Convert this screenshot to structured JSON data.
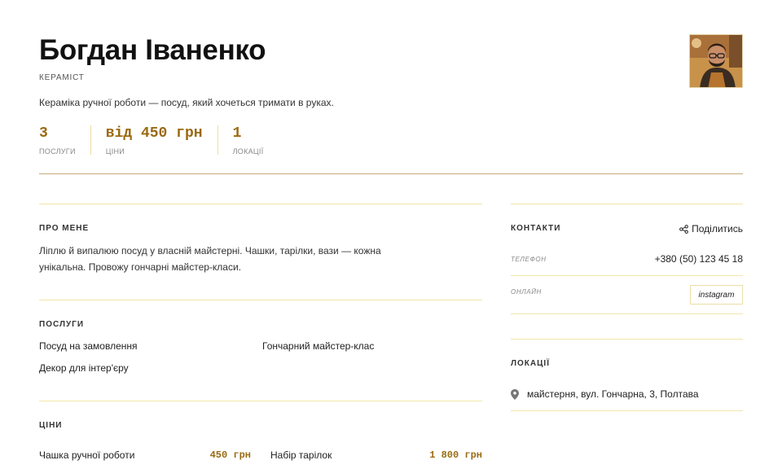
{
  "profile": {
    "name": "Богдан Іваненко",
    "role": "КЕРАМІСТ",
    "tagline": "Кераміка ручної роботи — посуд, який хочеться тримати в руках."
  },
  "stats": [
    {
      "value": "3",
      "label": "ПОСЛУГИ"
    },
    {
      "value": "від 450 грн",
      "label": "ЦІНИ"
    },
    {
      "value": "1",
      "label": "ЛОКАЦІЇ"
    }
  ],
  "about": {
    "title": "ПРО МЕНЕ",
    "line1": "Ліплю й випалюю посуд у власній майстерні. Чашки, тарілки, вази — кожна",
    "line2": "унікальна. Провожу гончарні майстер-класи."
  },
  "services": {
    "title": "ПОСЛУГИ",
    "items": [
      "Посуд на замовлення",
      "Гончарний майстер-клас",
      "Декор для інтер'єру"
    ]
  },
  "prices": {
    "title": "ЦІНИ",
    "items": [
      {
        "name": "Чашка ручної роботи",
        "price": "450 грн"
      },
      {
        "name": "Набір тарілок",
        "price": "1 800 грн"
      }
    ]
  },
  "contacts": {
    "title": "КОНТАКТИ",
    "share_label": "Поділитись",
    "phone_label": "ТЕЛЕФОН",
    "phone": "+380 (50) 123 45 18",
    "online_label": "ОНЛАЙН",
    "instagram": "instagram"
  },
  "locations": {
    "title": "ЛОКАЦІЇ",
    "items": [
      "майстерня, вул. Гончарна, 3, Полтава"
    ]
  },
  "colors": {
    "accent": "#9a6a12",
    "rule": "#c7aa73",
    "divider": "#f1e7a8"
  }
}
